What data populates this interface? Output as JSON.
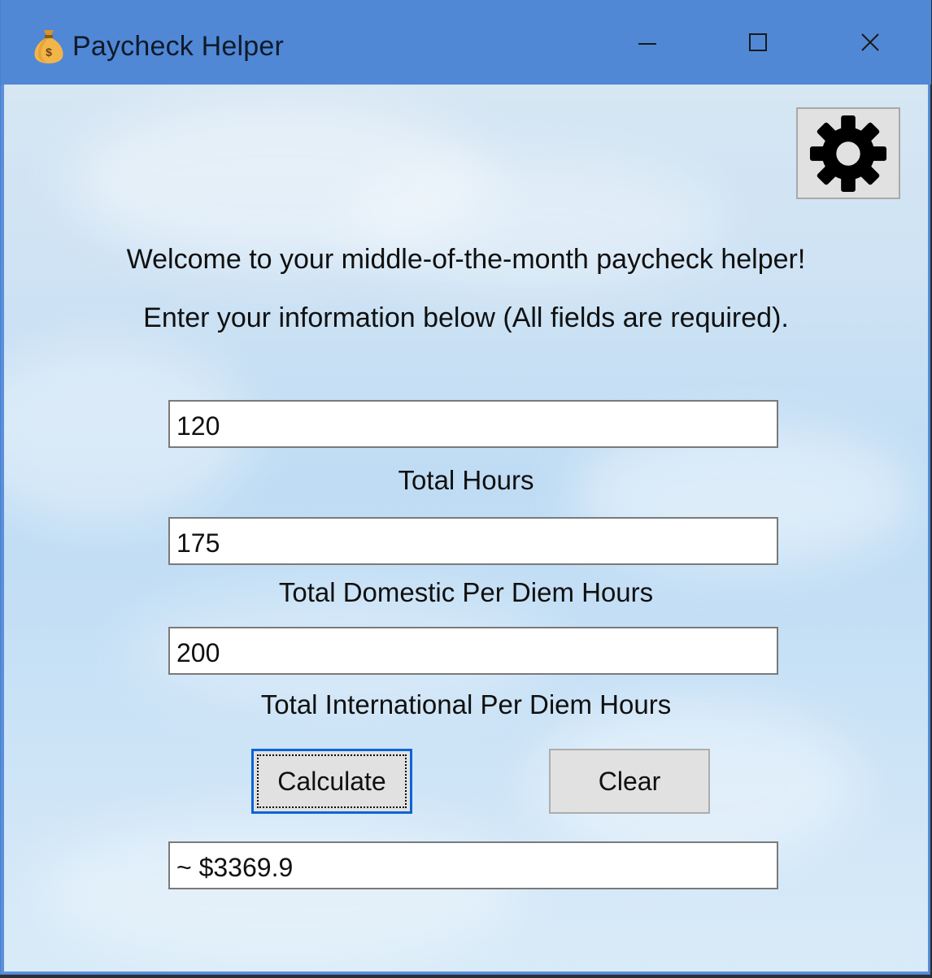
{
  "window": {
    "title": "Paycheck Helper",
    "accent_color": "#5088d6"
  },
  "header": {
    "welcome": "Welcome to your middle-of-the-month paycheck helper!",
    "instructions": "Enter your information below (All fields are required)."
  },
  "fields": {
    "total_hours": {
      "value": "120",
      "label": "Total Hours"
    },
    "domestic_per_diem": {
      "value": "175",
      "label": "Total Domestic Per Diem Hours"
    },
    "international_per_diem": {
      "value": "200",
      "label": "Total International Per Diem Hours"
    }
  },
  "buttons": {
    "calculate": "Calculate",
    "clear": "Clear"
  },
  "result": {
    "value": "~ $3369.9"
  },
  "icons": {
    "app": "money-bag-icon",
    "settings": "gear-icon",
    "minimize": "minimize-icon",
    "maximize": "maximize-icon",
    "close": "close-icon"
  }
}
